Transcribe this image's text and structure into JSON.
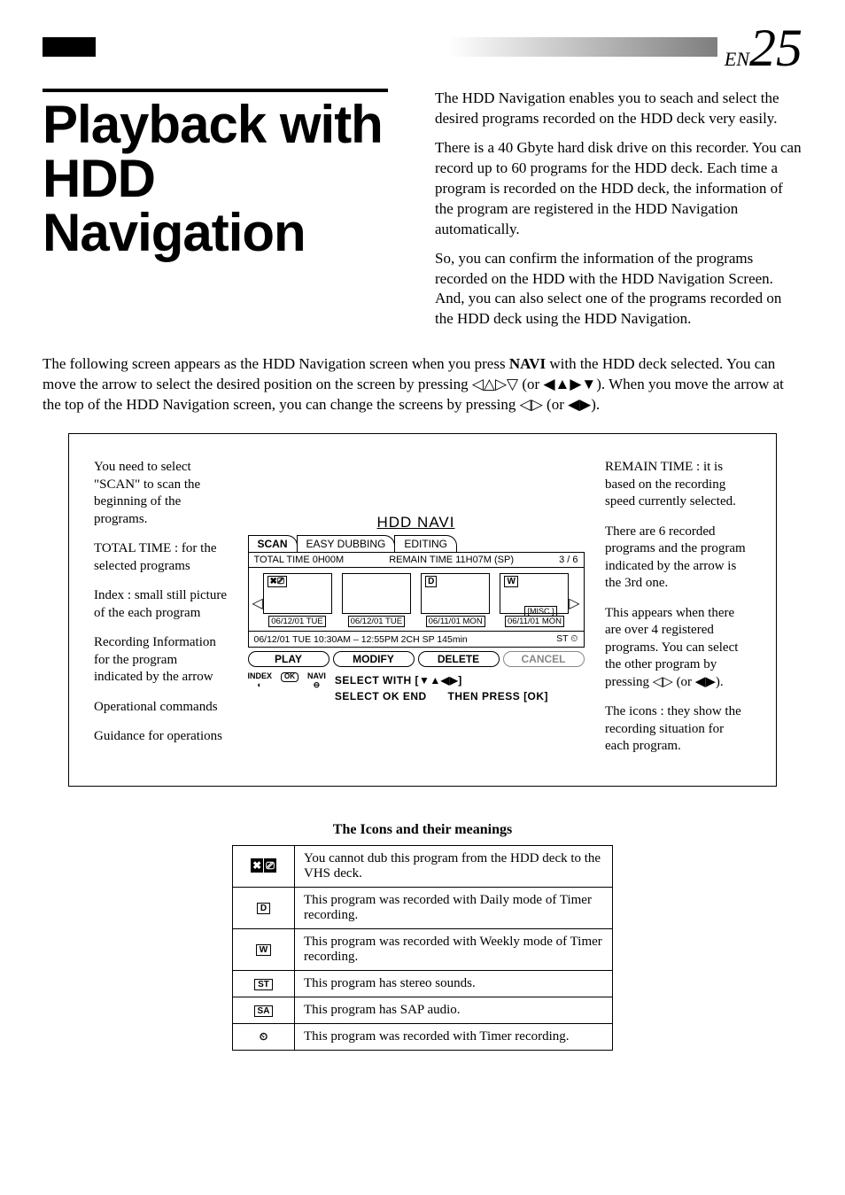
{
  "page": {
    "lang": "EN",
    "number": "25"
  },
  "title": "Playback with HDD Navigation",
  "intro": {
    "p1": "The HDD Navigation enables you to seach and select the desired programs recorded on the HDD deck very easily.",
    "p2": "There is a 40 Gbyte hard disk drive on this recorder. You can record up to 60 programs for the HDD deck. Each time a program is recorded on the HDD deck, the information of the program are registered in the HDD Navigation automatically.",
    "p3": "So, you can confirm the information of the programs recorded on the HDD with the HDD Navigation Screen. And, you can also select one of the programs recorded on the HDD deck using the HDD Navigation."
  },
  "body": {
    "p1a": "The following screen appears as the HDD Navigation screen when you press ",
    "p1b": "NAVI",
    "p1c": " with the HDD deck selected. You can move the arrow to select the desired position on the screen by pressing ◁△▷▽ (or ◀▲▶▼). When you move the arrow at the top of the HDD Navigation screen, you can change the screens by pressing ◁▷ (or ◀▶)."
  },
  "callouts_left": {
    "c1": "You need to select \"SCAN\" to scan the beginning of the programs.",
    "c2": "TOTAL TIME : for the selected programs",
    "c3": "Index : small still picture of the each program",
    "c4": "Recording Information for the program indicated by the arrow",
    "c5": "Operational commands",
    "c6": "Guidance for operations"
  },
  "callouts_right": {
    "c1": "REMAIN TIME : it is based on the recording speed currently selected.",
    "c2": "There are 6 recorded programs and the program indicated by the arrow is the 3rd one.",
    "c3": "This appears when there are over 4 registered programs. You can select the other program by pressing ◁▷ (or ◀▶).",
    "c4": "The icons : they show the recording situation for each program."
  },
  "screen": {
    "title": "HDD NAVI",
    "tabs": {
      "t1": "SCAN",
      "t2": "EASY DUBBING",
      "t3": "EDITING"
    },
    "total": "TOTAL TIME  0H00M",
    "remain": "REMAIN TIME 11H07M (SP)",
    "counter": "3 / 6",
    "thumbs": {
      "d1": "06/12/01 TUE",
      "d2": "06/12/01 TUE",
      "d3": "06/11/01 MON",
      "d4": "06/11/01 MON"
    },
    "misc": "[MISC.]",
    "detail": "06/12/01 TUE 10:30AM – 12:55PM  2CH   SP  145min",
    "detail_icons": "ST  ⏲",
    "cmds": {
      "play": "PLAY",
      "modify": "MODIFY",
      "delete": "DELETE",
      "cancel": "CANCEL"
    },
    "guidance": {
      "i1": "INDEX",
      "i2": "NAVI",
      "row1": "SELECT   OK    END",
      "row2a": "SELECT WITH  [▼▲◀▶]",
      "row2b": "THEN PRESS      [OK]"
    }
  },
  "icons_section": {
    "title": "The Icons and their meanings",
    "rows": {
      "r1": {
        "icon": "✖ ⎚",
        "text": "You cannot dub this program from the HDD deck to the VHS deck."
      },
      "r2": {
        "icon": "D",
        "text": "This program was recorded with Daily mode of Timer recording."
      },
      "r3": {
        "icon": "W",
        "text": "This program was recorded with Weekly mode of Timer recording."
      },
      "r4": {
        "icon": "ST",
        "text": "This program has stereo sounds."
      },
      "r5": {
        "icon": "SA",
        "text": "This program has SAP audio."
      },
      "r6": {
        "icon": "⏲",
        "text": "This program was recorded with Timer recording."
      }
    }
  }
}
